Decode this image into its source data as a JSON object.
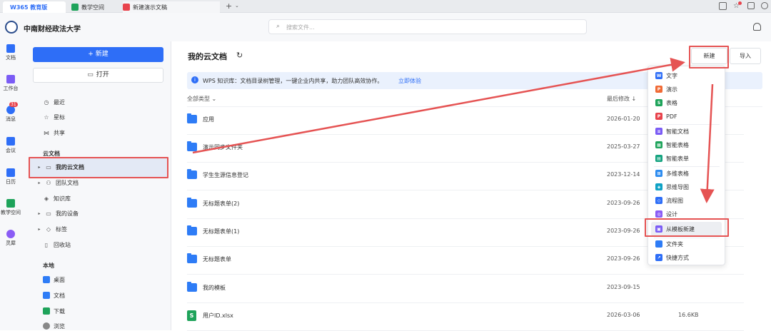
{
  "tabs": [
    {
      "label": "W365 教育版"
    },
    {
      "label": "教学空间"
    },
    {
      "label": "新建演示文稿"
    }
  ],
  "header": {
    "org_name": "中南财经政法大学",
    "search_placeholder": "搜索文件..."
  },
  "rail": [
    {
      "label": "文档"
    },
    {
      "label": "工作台"
    },
    {
      "label": "消息",
      "badge": "31"
    },
    {
      "label": "会议"
    },
    {
      "label": "日历"
    },
    {
      "label": "教学空间"
    },
    {
      "label": "灵犀"
    }
  ],
  "sidebar": {
    "new_label": "+ 新建",
    "open_label": "打开",
    "items": [
      {
        "label": "最近"
      },
      {
        "label": "星标"
      },
      {
        "label": "共享"
      }
    ],
    "cloud_section": "云文档",
    "cloud_items": [
      {
        "label": "我的云文档"
      },
      {
        "label": "团队文档"
      },
      {
        "label": "知识库"
      },
      {
        "label": "我的设备"
      },
      {
        "label": "标签"
      },
      {
        "label": "回收站"
      }
    ],
    "local_section": "本地",
    "local_items": [
      {
        "label": "桌面"
      },
      {
        "label": "文档"
      },
      {
        "label": "下载"
      },
      {
        "label": "浏览"
      }
    ]
  },
  "main": {
    "title": "我的云文档",
    "new_btn": "新建",
    "import_btn": "导入",
    "banner": "WPS 知识库：文档目录树管理，一键企业内共享，助力团队高效协作。",
    "banner_link": "立即体验",
    "col_type": "全部类型",
    "col_modified": "最后修改 ↓",
    "files": [
      {
        "name": "应用",
        "date": "2026-01-20",
        "size": ""
      },
      {
        "name": "演示同步文件夹",
        "date": "2025-03-27",
        "size": ""
      },
      {
        "name": "学生生源信息登记",
        "date": "2023-12-14",
        "size": ""
      },
      {
        "name": "无标题表单(2)",
        "date": "2023-09-26",
        "size": ""
      },
      {
        "name": "无标题表单(1)",
        "date": "2023-09-26",
        "size": ""
      },
      {
        "name": "无标题表单",
        "date": "2023-09-26",
        "size": ""
      },
      {
        "name": "我的模板",
        "date": "2023-09-15",
        "size": ""
      },
      {
        "name": "用户ID.xlsx",
        "date": "2026-03-06",
        "size": "16.6KB"
      }
    ]
  },
  "menu": {
    "items": [
      {
        "label": "文字",
        "icon": "W",
        "color": "#2e6ef7"
      },
      {
        "label": "演示",
        "icon": "P",
        "color": "#f06a35"
      },
      {
        "label": "表格",
        "icon": "S",
        "color": "#1ea35a"
      },
      {
        "label": "PDF",
        "icon": "P",
        "color": "#e8434c"
      },
      {
        "label": "智能文档",
        "icon": "≡",
        "color": "#7b5cf5"
      },
      {
        "label": "智能表格",
        "icon": "▦",
        "color": "#1ea35a"
      },
      {
        "label": "智能表单",
        "icon": "▤",
        "color": "#14a37f"
      },
      {
        "label": "多维表格",
        "icon": "⊞",
        "color": "#2d8cf0"
      },
      {
        "label": "思维导图",
        "icon": "◈",
        "color": "#0fa2c5"
      },
      {
        "label": "流程图",
        "icon": "◇",
        "color": "#2e6ef7"
      },
      {
        "label": "设计",
        "icon": "◎",
        "color": "#8a5cf5"
      },
      {
        "label": "从模板新建",
        "icon": "▣",
        "color": "#7b5cf5"
      },
      {
        "label": "文件夹",
        "icon": "",
        "color": "#2e7cf6"
      },
      {
        "label": "快捷方式",
        "icon": "↗",
        "color": "#2e6ef7"
      }
    ]
  },
  "colors": {
    "accent": "#2e6ef7",
    "annotation": "#e55353"
  }
}
